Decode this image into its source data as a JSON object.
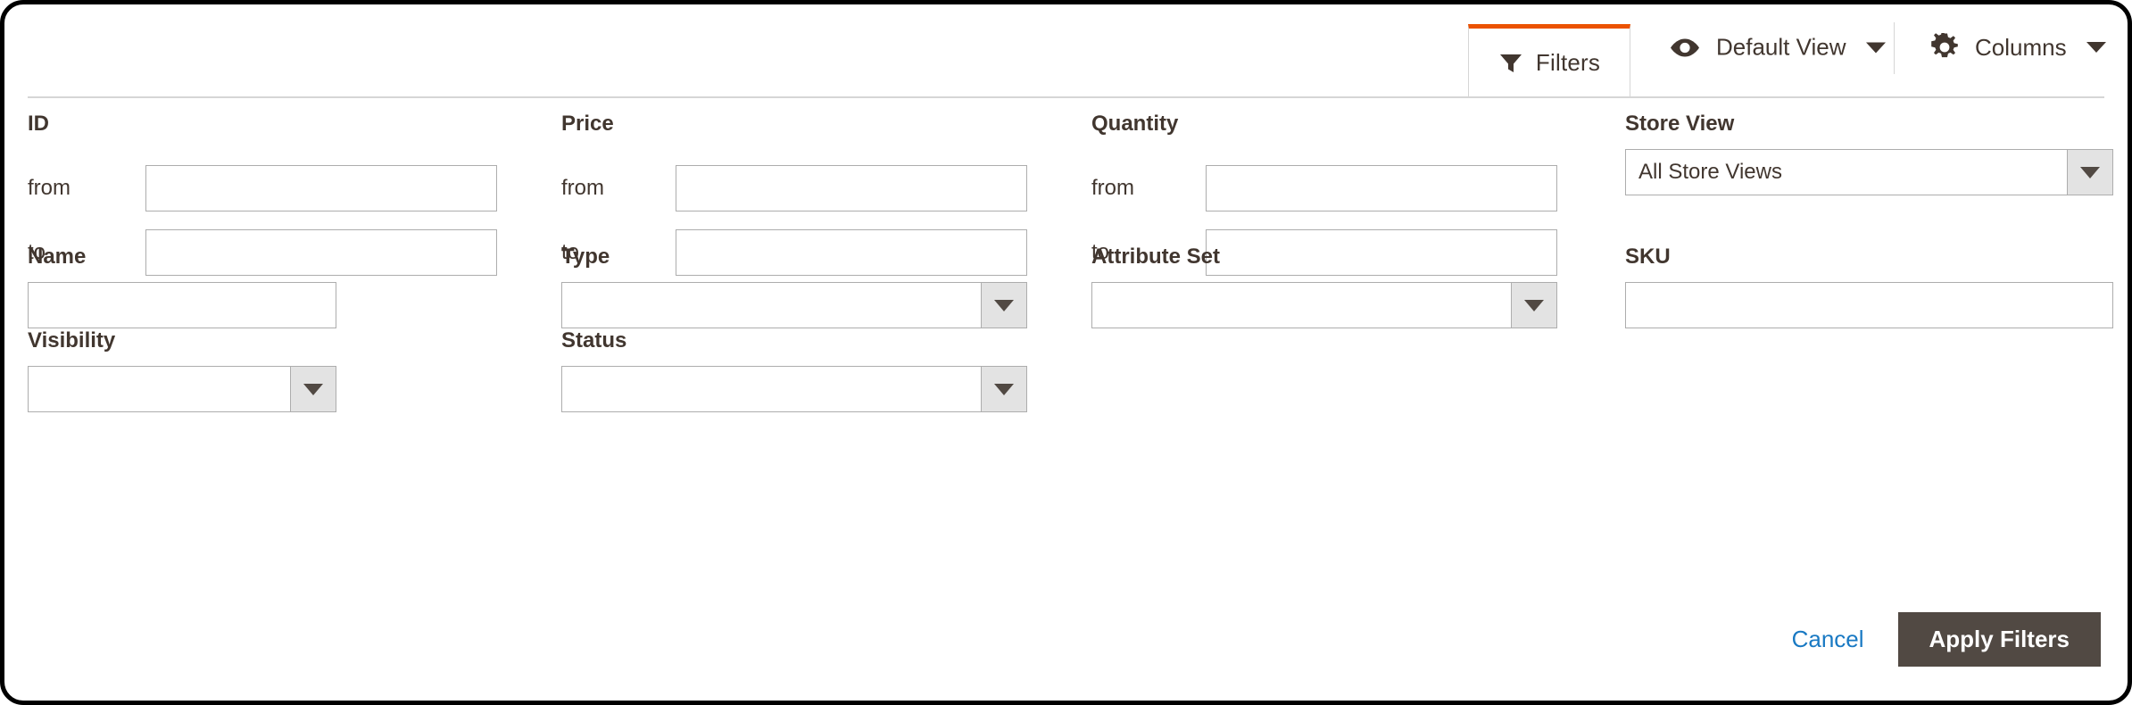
{
  "toolbar": {
    "filters_tab": {
      "label": "Filters",
      "icon": "funnel-icon",
      "active": true,
      "active_color": "#eb5202"
    },
    "view_selector": {
      "label": "Default View",
      "icon": "eye-icon",
      "caret": "chevron-down-icon"
    },
    "columns_selector": {
      "label": "Columns",
      "icon": "gear-icon",
      "caret": "chevron-down-icon"
    }
  },
  "filters": {
    "id": {
      "label": "ID",
      "from_label": "from",
      "to_label": "to",
      "from_value": "",
      "to_value": ""
    },
    "price": {
      "label": "Price",
      "from_label": "from",
      "to_label": "to",
      "from_value": "",
      "to_value": ""
    },
    "quantity": {
      "label": "Quantity",
      "from_label": "from",
      "to_label": "to",
      "from_value": "",
      "to_value": ""
    },
    "store_view": {
      "label": "Store View",
      "value": "All Store Views"
    },
    "name": {
      "label": "Name",
      "value": ""
    },
    "type": {
      "label": "Type",
      "value": ""
    },
    "attribute_set": {
      "label": "Attribute Set",
      "value": ""
    },
    "sku": {
      "label": "SKU",
      "value": ""
    },
    "visibility": {
      "label": "Visibility",
      "value": ""
    },
    "status": {
      "label": "Status",
      "value": ""
    }
  },
  "footer": {
    "cancel_label": "Cancel",
    "apply_label": "Apply Filters",
    "apply_bg": "#514943",
    "cancel_color": "#1979c3"
  }
}
